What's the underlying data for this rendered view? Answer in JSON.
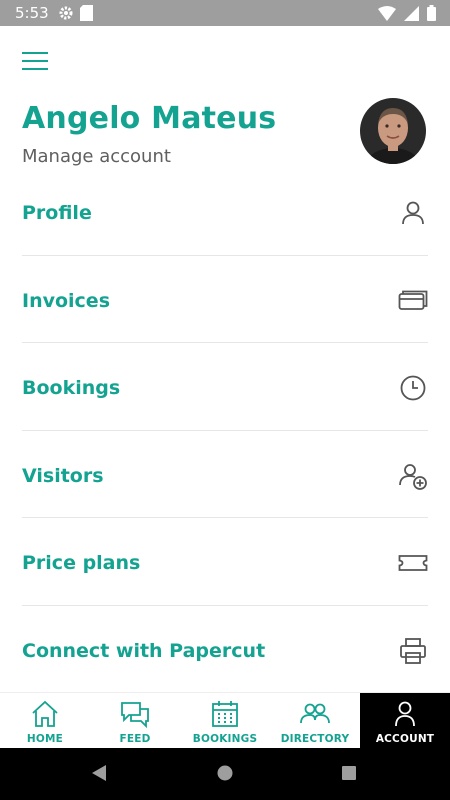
{
  "status_bar": {
    "time": "5:53"
  },
  "header": {
    "user_name": "Angelo Mateus",
    "subtitle": "Manage account"
  },
  "menu": {
    "items": [
      {
        "label": "Profile",
        "icon": "person-icon"
      },
      {
        "label": "Invoices",
        "icon": "wallet-icon"
      },
      {
        "label": "Bookings",
        "icon": "clock-icon"
      },
      {
        "label": "Visitors",
        "icon": "add-person-icon"
      },
      {
        "label": "Price plans",
        "icon": "ticket-icon"
      },
      {
        "label": "Connect with Papercut",
        "icon": "printer-icon"
      }
    ]
  },
  "bottom_nav": {
    "tabs": [
      {
        "label": "HOME",
        "icon": "home-icon",
        "active": false
      },
      {
        "label": "FEED",
        "icon": "chat-icon",
        "active": false
      },
      {
        "label": "BOOKINGS",
        "icon": "calendar-icon",
        "active": false
      },
      {
        "label": "DIRECTORY",
        "icon": "people-icon",
        "active": false
      },
      {
        "label": "ACCOUNT",
        "icon": "person-icon",
        "active": true
      }
    ]
  },
  "colors": {
    "accent": "#14a291",
    "status_bar": "#9e9e9e",
    "active_tab": "#000000"
  }
}
